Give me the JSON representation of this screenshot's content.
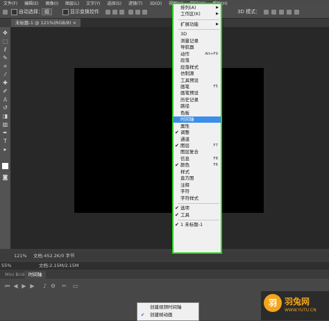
{
  "menubar": [
    "文件(F)",
    "编辑(E)",
    "图像(I)",
    "图层(L)",
    "文字(Y)",
    "选择(S)",
    "滤镜(T)",
    "3D(D)",
    "视图(V)",
    "窗口(W)",
    "帮助(H)"
  ],
  "options": {
    "auto_select_label": "自动选择：",
    "auto_select_value": "组",
    "show_transform_label": "显示变换控件",
    "mode_3d": "3D 模式："
  },
  "doc_tab": "未标题-1 @ 121%(RGB/8) ×",
  "status": {
    "zoom": "121%",
    "doc": "文档:452.2K/0 字节"
  },
  "bottom": {
    "zoom": "55%",
    "doc": "文档:2.15M/2.15M"
  },
  "panel_tabs": [
    "Mini Bridge",
    "时间轴"
  ],
  "window_menu": {
    "items": [
      {
        "label": "排列(A)",
        "submenu": true
      },
      {
        "label": "工作区(K)",
        "submenu": true
      },
      {
        "sep": true
      },
      {
        "label": "扩展功能",
        "submenu": true
      },
      {
        "sep": true
      },
      {
        "label": "3D"
      },
      {
        "label": "测量记录"
      },
      {
        "label": "导航器"
      },
      {
        "label": "动作",
        "shortcut": "Alt+F9"
      },
      {
        "label": "段落"
      },
      {
        "label": "段落样式"
      },
      {
        "label": "仿制源"
      },
      {
        "label": "工具预设"
      },
      {
        "label": "画笔",
        "shortcut": "F5"
      },
      {
        "label": "画笔预设"
      },
      {
        "label": "历史记录"
      },
      {
        "label": "路径"
      },
      {
        "label": "色板"
      },
      {
        "label": "时间轴",
        "highlight": true
      },
      {
        "label": "属性"
      },
      {
        "label": "调整",
        "checked": true
      },
      {
        "label": "通道"
      },
      {
        "label": "图层",
        "shortcut": "F7",
        "checked": true
      },
      {
        "label": "图层复合"
      },
      {
        "label": "信息",
        "shortcut": "F8"
      },
      {
        "label": "颜色",
        "shortcut": "F6",
        "checked": true
      },
      {
        "label": "样式"
      },
      {
        "label": "直方图"
      },
      {
        "label": "注释"
      },
      {
        "label": "字符"
      },
      {
        "label": "字符样式"
      },
      {
        "sep": true
      },
      {
        "label": "选项",
        "checked": true
      },
      {
        "label": "工具",
        "checked": true
      },
      {
        "sep": true
      },
      {
        "label": "1 未标题-1",
        "checked": true
      }
    ]
  },
  "timeline_popup": {
    "items": [
      {
        "label": "创建视频时间轴",
        "checked": false
      },
      {
        "label": "创建帧动画",
        "checked": true
      }
    ]
  },
  "watermark": {
    "logo_glyph": "羽",
    "name": "羽兔网",
    "url": "WWW.YUTU.CN"
  },
  "colors": {
    "menu_border": "#2bd41f",
    "menu_highlight": "#3c8ee8",
    "watermark": "#f3a51c"
  }
}
